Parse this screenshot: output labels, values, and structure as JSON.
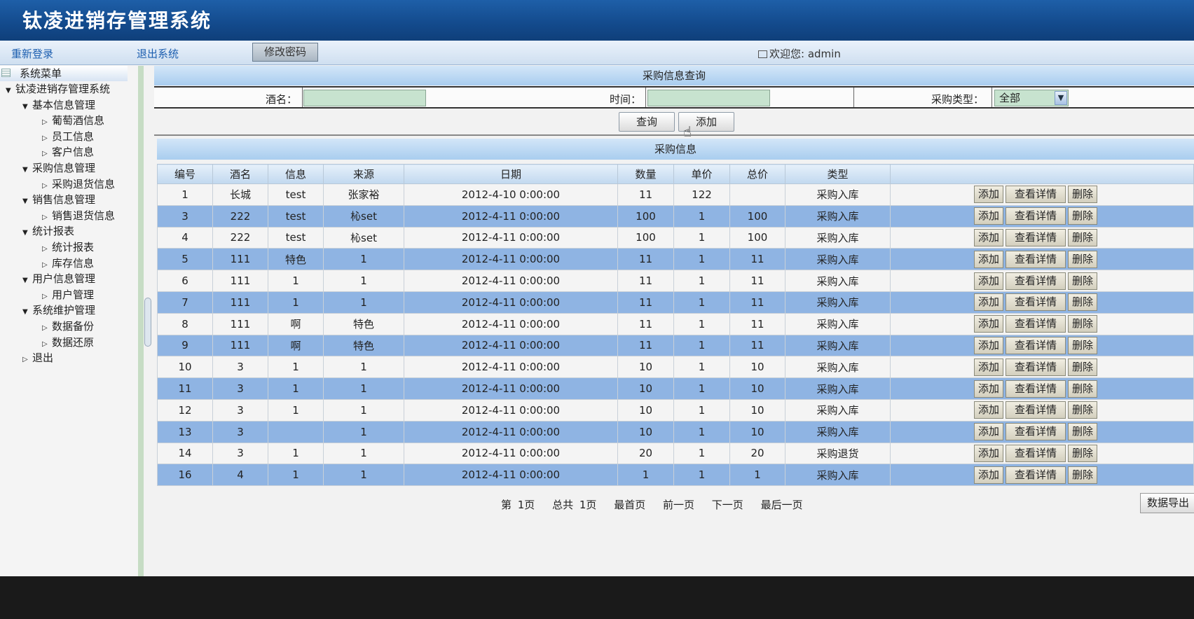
{
  "app_title": "钛凌进销存管理系统",
  "toolbar": {
    "relogin": "重新登录",
    "logout": "退出系统",
    "change_password": "修改密码",
    "welcome": "欢迎您: admin"
  },
  "sidebar": {
    "header": "系统菜单",
    "items": [
      {
        "label": "钛凌进销存管理系统",
        "level": 0,
        "arrow": "down"
      },
      {
        "label": "基本信息管理",
        "level": 1,
        "arrow": "down"
      },
      {
        "label": "葡萄酒信息",
        "level": 2,
        "arrow": "right"
      },
      {
        "label": "员工信息",
        "level": 2,
        "arrow": "right"
      },
      {
        "label": "客户信息",
        "level": 2,
        "arrow": "right"
      },
      {
        "label": "采购信息管理",
        "level": 1,
        "arrow": "down"
      },
      {
        "label": "采购退货信息",
        "level": 2,
        "arrow": "right"
      },
      {
        "label": "销售信息管理",
        "level": 1,
        "arrow": "down"
      },
      {
        "label": "销售退货信息",
        "level": 2,
        "arrow": "right"
      },
      {
        "label": "统计报表",
        "level": 1,
        "arrow": "down"
      },
      {
        "label": "统计报表",
        "level": 2,
        "arrow": "right"
      },
      {
        "label": "库存信息",
        "level": 2,
        "arrow": "right"
      },
      {
        "label": "用户信息管理",
        "level": 1,
        "arrow": "down"
      },
      {
        "label": "用户管理",
        "level": 2,
        "arrow": "right"
      },
      {
        "label": "系统维护管理",
        "level": 1,
        "arrow": "down"
      },
      {
        "label": "数据备份",
        "level": 2,
        "arrow": "right"
      },
      {
        "label": "数据还原",
        "level": 2,
        "arrow": "right"
      },
      {
        "label": "退出",
        "level": 1,
        "arrow": "right"
      }
    ]
  },
  "query": {
    "title": "采购信息查询",
    "wine_label": "酒名：",
    "wine_value": "",
    "time_label": "时间：",
    "time_value": "",
    "type_label": "采购类型：",
    "type_selected": "全部",
    "search_button": "查询",
    "add_button": "添加"
  },
  "results": {
    "title": "采购信息",
    "columns": [
      "编号",
      "酒名",
      "信息",
      "来源",
      "日期",
      "数量",
      "单价",
      "总价",
      "类型",
      ""
    ],
    "rows": [
      [
        "1",
        "长城",
        "test",
        "张家裕",
        "2012-4-10 0:00:00",
        "11",
        "122",
        "",
        "采购入库"
      ],
      [
        "3",
        "222",
        "test",
        "杺set",
        "2012-4-11 0:00:00",
        "100",
        "1",
        "100",
        "采购入库"
      ],
      [
        "4",
        "222",
        "test",
        "杺set",
        "2012-4-11 0:00:00",
        "100",
        "1",
        "100",
        "采购入库"
      ],
      [
        "5",
        "111",
        "特色",
        "1",
        "2012-4-11 0:00:00",
        "11",
        "1",
        "11",
        "采购入库"
      ],
      [
        "6",
        "111",
        "1",
        "1",
        "2012-4-11 0:00:00",
        "11",
        "1",
        "11",
        "采购入库"
      ],
      [
        "7",
        "111",
        "1",
        "1",
        "2012-4-11 0:00:00",
        "11",
        "1",
        "11",
        "采购入库"
      ],
      [
        "8",
        "111",
        "啊",
        "特色",
        "2012-4-11 0:00:00",
        "11",
        "1",
        "11",
        "采购入库"
      ],
      [
        "9",
        "111",
        "啊",
        "特色",
        "2012-4-11 0:00:00",
        "11",
        "1",
        "11",
        "采购入库"
      ],
      [
        "10",
        "3",
        "1",
        "1",
        "2012-4-11 0:00:00",
        "10",
        "1",
        "10",
        "采购入库"
      ],
      [
        "11",
        "3",
        "1",
        "1",
        "2012-4-11 0:00:00",
        "10",
        "1",
        "10",
        "采购入库"
      ],
      [
        "12",
        "3",
        "1",
        "1",
        "2012-4-11 0:00:00",
        "10",
        "1",
        "10",
        "采购入库"
      ],
      [
        "13",
        "3",
        "",
        "1",
        "2012-4-11 0:00:00",
        "10",
        "1",
        "10",
        "采购入库"
      ],
      [
        "14",
        "3",
        "1",
        "1",
        "2012-4-11 0:00:00",
        "20",
        "1",
        "20",
        "采购退货"
      ],
      [
        "16",
        "4",
        "1",
        "1",
        "2012-4-11 0:00:00",
        "1",
        "1",
        "1",
        "采购入库"
      ]
    ],
    "row_actions": [
      "添加",
      "查看详情",
      "删除"
    ]
  },
  "pager": {
    "current": "第 1页",
    "total": "总共 1页",
    "first": "最首页",
    "prev": "前一页",
    "next": "下一页",
    "last": "最后一页"
  },
  "export_button": "数据导出",
  "colors": {
    "header_blue": "#134a8c",
    "row_alt": "#8fb4e3",
    "input_green": "#c7e3cf"
  }
}
